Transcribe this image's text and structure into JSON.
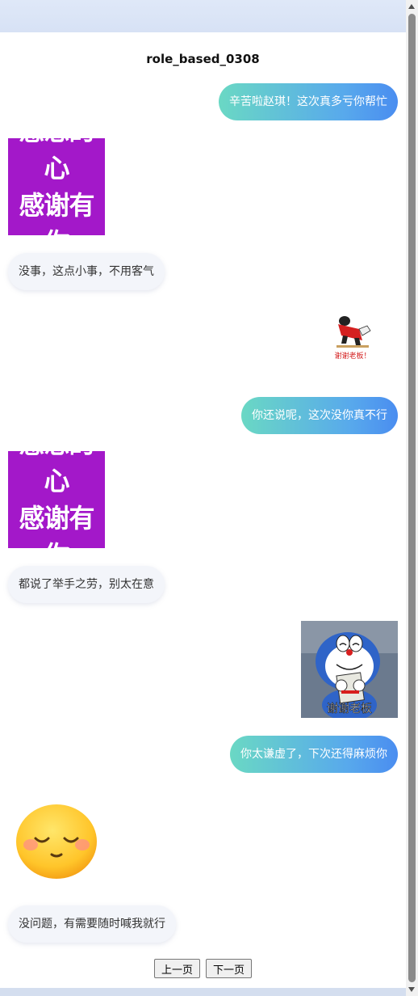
{
  "page": {
    "title": "role_based_0308"
  },
  "messages": {
    "m1": "辛苦啦赵琪！这次真多亏你帮忙",
    "m2_sticker": [
      "感恩的心",
      "感谢有你"
    ],
    "m3": "没事，这点小事，不用客气",
    "m4_sticker_caption": "谢谢老板！",
    "m5": "你还说呢，这次没你真不行",
    "m6_sticker": [
      "感恩的心",
      "感谢有你"
    ],
    "m7": "都说了举手之劳，别太在意",
    "m8_sticker_caption": "谢谢老板",
    "m9": "你太谦虚了，下次还得麻烦你",
    "m10_sticker": "smiling-content-face",
    "m11": "没问题，有需要随时喊我就行"
  },
  "pager": {
    "prev": "上一页",
    "next": "下一页"
  },
  "colors": {
    "right_bubble_start": "#6ad8c4",
    "right_bubble_end": "#4a8df0",
    "left_bubble": "#f3f5fa",
    "sticker_purple": "#a318c9"
  }
}
